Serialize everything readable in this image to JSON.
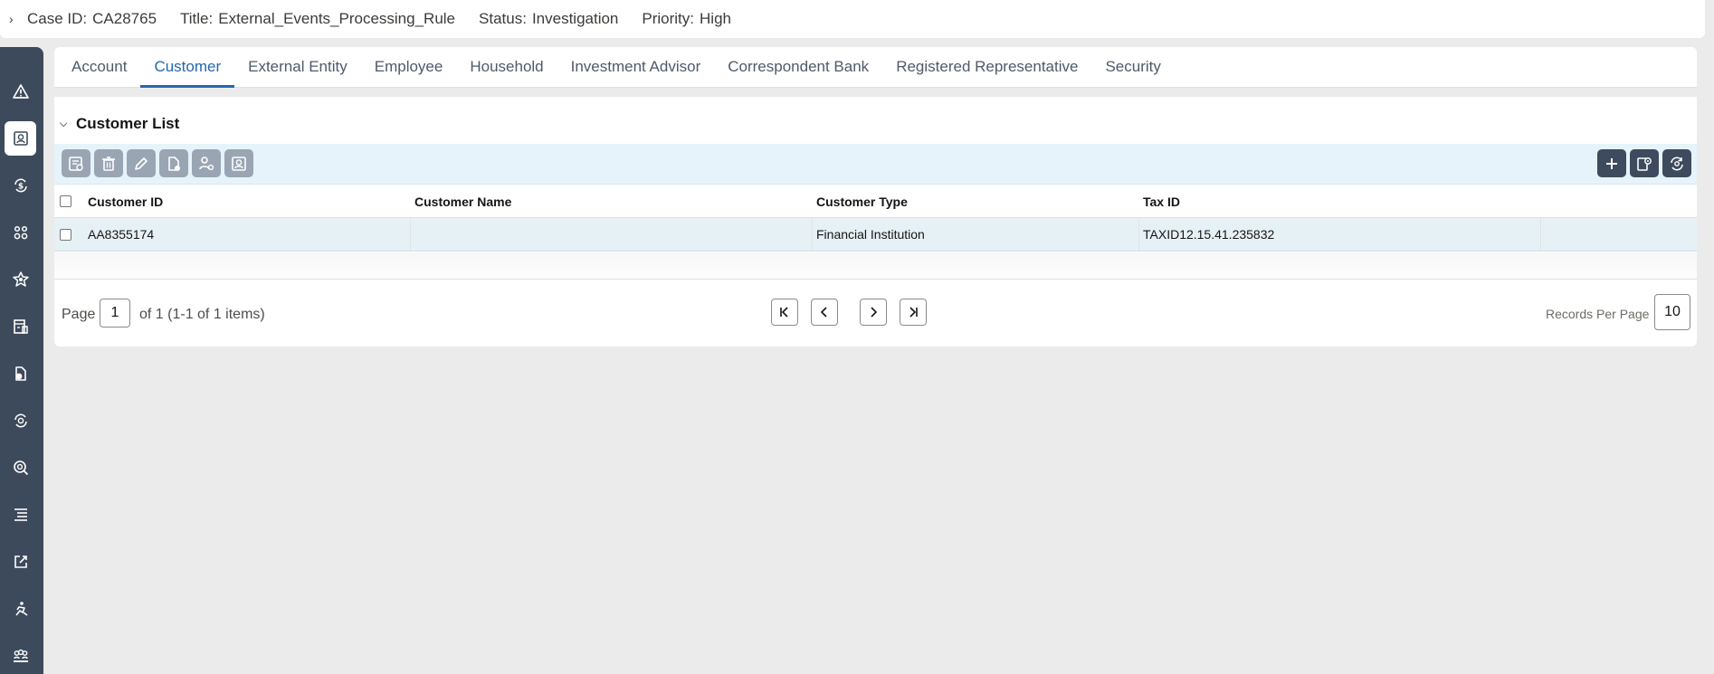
{
  "case": {
    "id_label": "Case ID:",
    "id_value": "CA28765",
    "title_label": "Title:",
    "title_value": "External_Events_Processing_Rule",
    "status_label": "Status:",
    "status_value": "Investigation",
    "priority_label": "Priority:",
    "priority_value": "High"
  },
  "nav": {
    "items": [
      {
        "icon": "alert-triangle-icon"
      },
      {
        "icon": "customer-profile-icon",
        "active": true
      },
      {
        "icon": "refresh-dollar-icon"
      },
      {
        "icon": "people-link-icon"
      },
      {
        "icon": "badge-star-icon"
      },
      {
        "icon": "building-icon"
      },
      {
        "icon": "document-dollar-icon"
      },
      {
        "icon": "cycle-dollar-icon"
      },
      {
        "icon": "target-search-icon"
      },
      {
        "icon": "list-lines-icon"
      },
      {
        "icon": "expand-arrow-icon"
      },
      {
        "icon": "person-run-icon"
      },
      {
        "icon": "group-icon"
      }
    ]
  },
  "tabs": [
    {
      "label": "Account"
    },
    {
      "label": "Customer",
      "active": true
    },
    {
      "label": "External Entity"
    },
    {
      "label": "Employee"
    },
    {
      "label": "Household"
    },
    {
      "label": "Investment Advisor"
    },
    {
      "label": "Correspondent Bank"
    },
    {
      "label": "Registered Representative"
    },
    {
      "label": "Security"
    }
  ],
  "section": {
    "title": "Customer List"
  },
  "grid": {
    "columns": [
      "Customer ID",
      "Customer Name",
      "Customer Type",
      "Tax ID"
    ],
    "rows": [
      {
        "customer_id": "AA8355174",
        "customer_name": "",
        "customer_type": "Financial Institution",
        "tax_id": "TAXID12.15.41.235832"
      }
    ]
  },
  "pager": {
    "page_label": "Page",
    "page_value": "1",
    "summary": "of 1 (1-1 of 1 items)",
    "records_label": "Records Per Page",
    "records_value": "10"
  },
  "colors": {
    "rail": "#3d4a5c",
    "accent": "#2566b0",
    "toolbar": "#e6f3fa"
  }
}
